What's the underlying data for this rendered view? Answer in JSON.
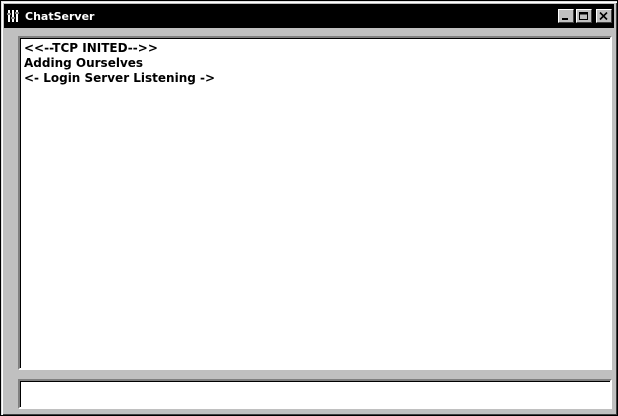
{
  "window": {
    "title": "ChatServer",
    "app_icon": "chat-server-icon"
  },
  "controls": {
    "minimize_icon": "minimize-icon",
    "maximize_icon": "maximize-icon",
    "close_icon": "close-icon"
  },
  "log": {
    "lines": [
      "<<--TCP INITED-->>",
      "Adding Ourselves",
      "<- Login Server Listening ->"
    ]
  },
  "input": {
    "value": "",
    "placeholder": ""
  },
  "colors": {
    "titlebar": "#000000",
    "window_face": "#c0c0c0",
    "text_area": "#ffffff"
  }
}
